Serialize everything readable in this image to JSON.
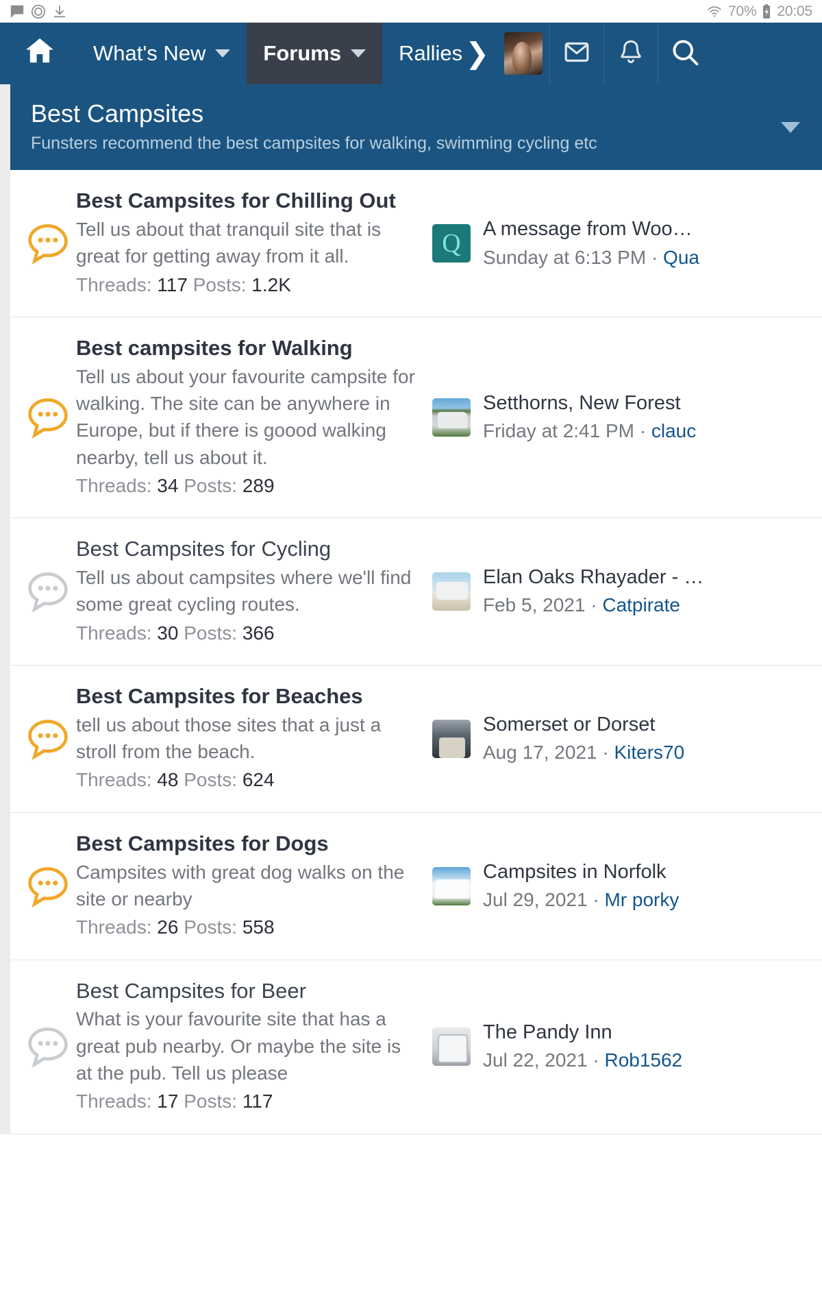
{
  "statusbar": {
    "icons_left": [
      "message-icon",
      "record-icon",
      "download-icon"
    ],
    "wifi_icon": "wifi-icon",
    "battery_percent": "70%",
    "battery_icon": "battery-charging-icon",
    "time": "20:05"
  },
  "navbar": {
    "home_icon": "home-icon",
    "items": [
      {
        "label": "What's New",
        "has_caret": true,
        "active": false
      },
      {
        "label": "Forums",
        "has_caret": true,
        "active": true
      },
      {
        "label": "Rallies",
        "has_caret": false,
        "active": false
      }
    ],
    "chevron": "❯",
    "avatar": "user-avatar",
    "inbox_icon": "envelope-icon",
    "alerts_icon": "bell-icon",
    "search_icon": "search-icon"
  },
  "forum_header": {
    "title": "Best Campsites",
    "description": "Funsters recommend the best campsites for walking, swimming cycling etc",
    "caret": "chevron-down-icon"
  },
  "forums": [
    {
      "title": "Best Campsites for Chilling Out",
      "unread": true,
      "description": "Tell us about that tranquil site that is great for getting away from it all.",
      "threads_label": "Threads:",
      "threads": "117",
      "posts_label": "Posts:",
      "posts": "1.2K",
      "last_post": {
        "thumb": "th-q",
        "thumb_letter": "Q",
        "title": "A message from Woo…",
        "date": "Sunday at 6:13 PM",
        "separator": "·",
        "author": "Qua"
      }
    },
    {
      "title": "Best campsites for Walking",
      "unread": true,
      "description": "Tell us about your favourite campsite for walking. The site can be anywhere in Europe, but if there is goood walking nearby, tell us about it.",
      "threads_label": "Threads:",
      "threads": "34",
      "posts_label": "Posts:",
      "posts": "289",
      "last_post": {
        "thumb": "th-van1",
        "thumb_letter": "",
        "title": "Setthorns, New Forest",
        "date": "Friday at 2:41 PM",
        "separator": "·",
        "author": "clauс"
      }
    },
    {
      "title": "Best Campsites for Cycling",
      "unread": false,
      "description": "Tell us about campsites where we'll find some great cycling routes.",
      "threads_label": "Threads:",
      "threads": "30",
      "posts_label": "Posts:",
      "posts": "366",
      "last_post": {
        "thumb": "th-van2",
        "thumb_letter": "",
        "title": "Elan Oaks Rhayader - …",
        "date": "Feb 5, 2021",
        "separator": "·",
        "author": "Catpirate"
      }
    },
    {
      "title": "Best Campsites for Beaches",
      "unread": true,
      "description": "tell us about those sites that a just a stroll from the beach.",
      "threads_label": "Threads:",
      "threads": "48",
      "posts_label": "Posts:",
      "posts": "624",
      "last_post": {
        "thumb": "th-suits",
        "thumb_letter": "",
        "title": "Somerset or Dorset",
        "date": "Aug 17, 2021",
        "separator": "·",
        "author": "Kiters70"
      }
    },
    {
      "title": "Best Campsites for Dogs",
      "unread": true,
      "description": "Campsites with great dog walks on the site or nearby",
      "threads_label": "Threads:",
      "threads": "26",
      "posts_label": "Posts:",
      "posts": "558",
      "last_post": {
        "thumb": "th-bus",
        "thumb_letter": "",
        "title": "Campsites in Norfolk",
        "date": "Jul 29, 2021",
        "separator": "·",
        "author": "Mr porky"
      }
    },
    {
      "title": "Best Campsites for Beer",
      "unread": false,
      "description": "What is your favourite site that has a great pub nearby. Or maybe the site is at the pub. Tell us please",
      "threads_label": "Threads:",
      "threads": "17",
      "posts_label": "Posts:",
      "posts": "117",
      "last_post": {
        "thumb": "th-mh",
        "thumb_letter": "",
        "title": "The Pandy Inn",
        "date": "Jul 22, 2021",
        "separator": "·",
        "author": "Rob1562"
      }
    }
  ],
  "colors": {
    "nav_blue": "#1b5480",
    "nav_active": "#3a404b",
    "unread_icon": "#f0a82a",
    "read_icon": "#c9ccd0",
    "link_blue": "#14558c"
  }
}
